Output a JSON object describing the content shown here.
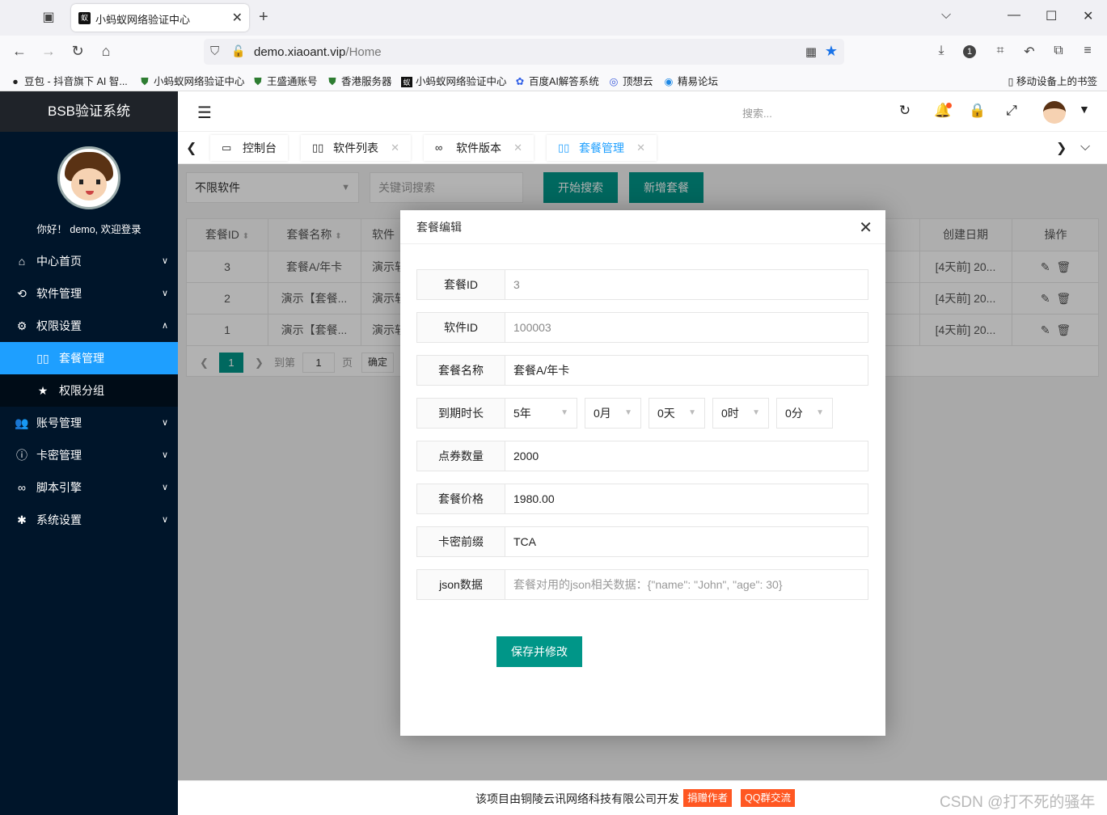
{
  "browser": {
    "tab_title": "小蚂蚁网络验证中心",
    "tab_favicon": "蚁",
    "url_host": "demo.xiaoant.vip",
    "url_path": "/Home",
    "bookmarks": [
      "豆包 - 抖音旗下 AI 智...",
      "小蚂蚁网络验证中心",
      "王盛通账号",
      "香港服务器",
      "小蚂蚁网络验证中心",
      "百度AI解答系统",
      "顶想云",
      "精易论坛"
    ],
    "mobile_bookmarks": "移动设备上的书签",
    "notification_count": "1"
  },
  "sidebar": {
    "brand": "BSB验证系统",
    "welcome": "你好！ demo, 欢迎登录",
    "items": [
      {
        "label": "中心首页"
      },
      {
        "label": "软件管理"
      },
      {
        "label": "权限设置"
      },
      {
        "label": "套餐管理"
      },
      {
        "label": "权限分组"
      },
      {
        "label": "账号管理"
      },
      {
        "label": "卡密管理"
      },
      {
        "label": "脚本引擎"
      },
      {
        "label": "系统设置"
      }
    ]
  },
  "header": {
    "search_placeholder": "搜索..."
  },
  "page_tabs": [
    "控制台",
    "软件列表",
    "软件版本",
    "套餐管理"
  ],
  "toolbar": {
    "software_select": "不限软件",
    "keyword_placeholder": "关键词搜索",
    "search_btn": "开始搜索",
    "add_btn": "新增套餐"
  },
  "table": {
    "columns": [
      "套餐ID",
      "套餐名称",
      "软件",
      "创建日期",
      "操作"
    ],
    "rows": [
      {
        "id": "3",
        "name": "套餐A/年卡",
        "soft": "演示软",
        "date": "[4天前] 20..."
      },
      {
        "id": "2",
        "name": "演示【套餐...",
        "soft": "演示软",
        "date": "[4天前] 20..."
      },
      {
        "id": "1",
        "name": "演示【套餐...",
        "soft": "演示软",
        "date": "[4天前] 20..."
      }
    ],
    "pager": {
      "current": "1",
      "goto_label": "到第",
      "goto_value": "1",
      "page_label": "页",
      "confirm": "确定"
    }
  },
  "modal": {
    "title": "套餐编辑",
    "fields": {
      "id_label": "套餐ID",
      "id_value": "3",
      "soft_label": "软件ID",
      "soft_value": "100003",
      "name_label": "套餐名称",
      "name_value": "套餐A/年卡",
      "duration_label": "到期时长",
      "duration_year": "5年",
      "duration_month": "0月",
      "duration_day": "0天",
      "duration_hour": "0时",
      "duration_minute": "0分",
      "points_label": "点券数量",
      "points_value": "2000",
      "price_label": "套餐价格",
      "price_value": "1980.00",
      "prefix_label": "卡密前缀",
      "prefix_value": "TCA",
      "json_label": "json数据",
      "json_placeholder": "套餐对用的json相关数据：{\"name\": \"John\", \"age\": 30}"
    },
    "save_btn": "保存并修改"
  },
  "footer": {
    "text": "该项目由铜陵云讯网络科技有限公司开发",
    "donate": "捐赠作者",
    "qq": "QQ群交流",
    "watermark": "CSDN @打不死的骚年"
  },
  "colors": {
    "primary": "#009688",
    "accent": "#1e9fff",
    "sidebar": "#00152a",
    "danger": "#ff5722"
  }
}
